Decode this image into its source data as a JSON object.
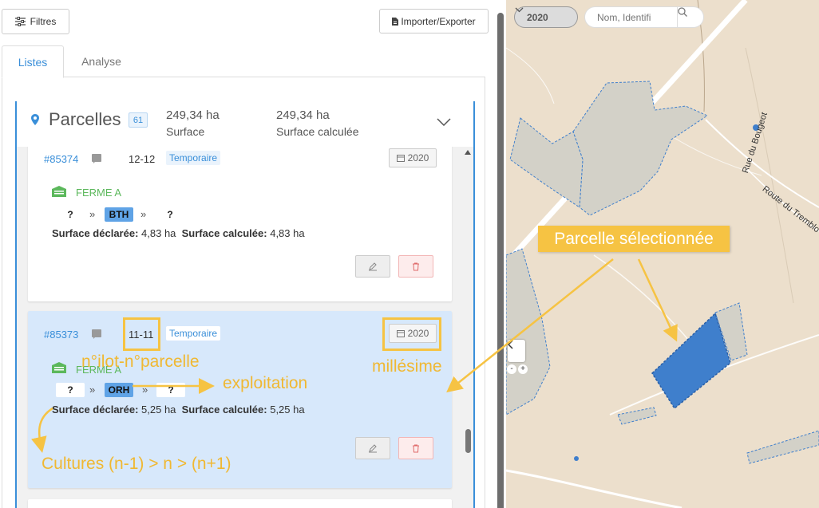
{
  "toolbar": {
    "filters_label": "Filtres",
    "export_label": "Importer/Exporter"
  },
  "tabs": [
    {
      "label": "Listes",
      "active": true
    },
    {
      "label": "Analyse",
      "active": false
    }
  ],
  "parcelles": {
    "title": "Parcelles",
    "count": "61",
    "stats": [
      {
        "value": "249,34 ha",
        "label": "Surface"
      },
      {
        "value": "249,34 ha",
        "label": "Surface calculée"
      }
    ]
  },
  "cards": [
    {
      "id": "#85374",
      "ilot": "12-12",
      "type": "Temporaire",
      "year": "2020",
      "farm": "FERME A",
      "crops": [
        "?",
        "BTH",
        "?"
      ],
      "surface_declared_label": "Surface déclarée:",
      "surface_declared": "4,83 ha",
      "surface_calc_label": "Surface calculée:",
      "surface_calc": "4,83 ha",
      "selected": false
    },
    {
      "id": "#85373",
      "ilot": "11-11",
      "type": "Temporaire",
      "year": "2020",
      "farm": "FERME A",
      "crops": [
        "?",
        "ORH",
        "?"
      ],
      "surface_declared_label": "Surface déclarée:",
      "surface_declared": "5,25 ha",
      "surface_calc_label": "Surface calculée:",
      "surface_calc": "5,25 ha",
      "selected": true
    }
  ],
  "annotations": {
    "ilot": "n°ilot-n°parcelle",
    "exploitation": "exploitation",
    "millesime": "millésime",
    "cultures": "Cultures (n-1) > n > (n+1)",
    "selected_parcel": "Parcelle sélectionnée"
  },
  "map": {
    "year": "2020",
    "search_placeholder": "Nom, Identifi",
    "roads": [
      "Rue du Bougeot",
      "Route du Tremblo"
    ]
  },
  "colors": {
    "accent": "#3a8fd9",
    "farm_green": "#5cb85c",
    "annotation": "#f6c343",
    "selected_card": "#d7e8fb",
    "selected_parcel": "#3f7fcc",
    "map_bg": "#ecdfcc"
  }
}
